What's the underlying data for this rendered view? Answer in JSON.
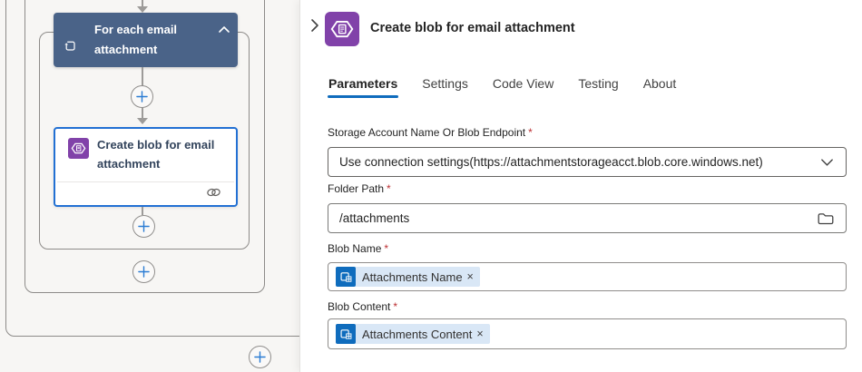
{
  "canvas": {
    "foreach": {
      "title": "For each email attachment"
    },
    "action_card": {
      "title": "Create blob for email attachment"
    }
  },
  "panel": {
    "title": "Create blob for email attachment",
    "tabs": [
      {
        "label": "Parameters",
        "active": true
      },
      {
        "label": "Settings",
        "active": false
      },
      {
        "label": "Code View",
        "active": false
      },
      {
        "label": "Testing",
        "active": false
      },
      {
        "label": "About",
        "active": false
      }
    ],
    "fields": {
      "storage": {
        "label": "Storage Account Name Or Blob Endpoint",
        "required": "*",
        "value": "Use connection settings(https://attachmentstorageacct.blob.core.windows.net)"
      },
      "folder": {
        "label": "Folder Path",
        "required": "*",
        "value": "/attachments"
      },
      "blob_name": {
        "label": "Blob Name",
        "required": "*",
        "token": "Attachments Name",
        "close": "×"
      },
      "blob_content": {
        "label": "Blob Content",
        "required": "*",
        "token": "Attachments Content",
        "close": "×"
      }
    },
    "colors": {
      "accent_blue": "#0f6cbd",
      "selected_card_border": "#2270d3",
      "scope_header": "#4a6388",
      "connector_purple": "#8142a9",
      "token_bg": "#d9e7f6",
      "required_red": "#bc2f32"
    }
  }
}
